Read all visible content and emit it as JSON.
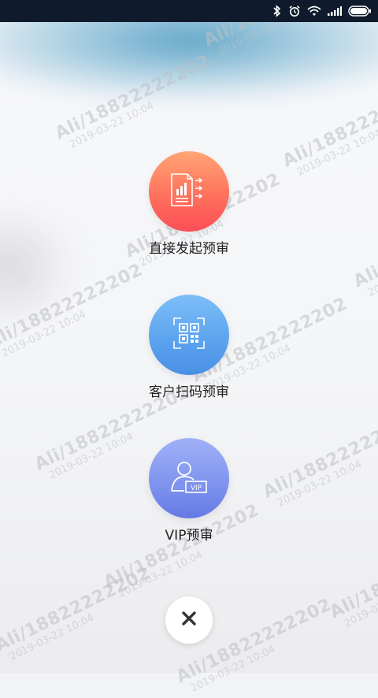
{
  "status_bar": {
    "icons": [
      "bluetooth-icon",
      "alarm-icon",
      "wifi-icon",
      "signal-icon",
      "battery-icon"
    ]
  },
  "actions": [
    {
      "label": "直接发起预审",
      "icon": "document-send-icon",
      "color": "#ff6d5c"
    },
    {
      "label": "客户扫码预审",
      "icon": "qr-scan-icon",
      "color": "#5aa2ee"
    },
    {
      "label": "VIP预审",
      "icon": "vip-user-icon",
      "color": "#7e92ee"
    }
  ],
  "close_button": {
    "icon": "close-icon"
  },
  "watermark": {
    "line1": "Ali/18822222202",
    "line2": "2019-03-22 10:04"
  }
}
